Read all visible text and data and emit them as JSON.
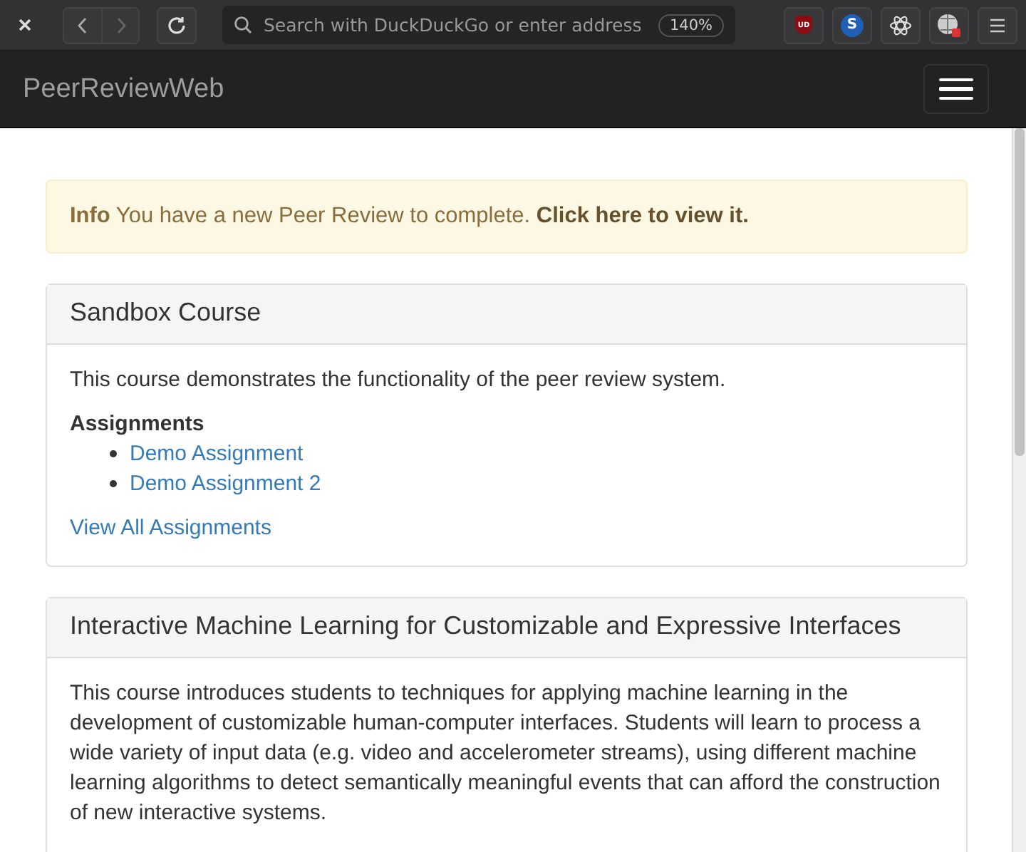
{
  "browser": {
    "search": {
      "placeholder": "Search with DuckDuckGo or enter address"
    },
    "zoom": "140%",
    "extensions": [
      {
        "kind": "shield",
        "label": "UD"
      },
      {
        "kind": "badge",
        "label": "S"
      },
      {
        "kind": "atom"
      },
      {
        "kind": "globe"
      }
    ]
  },
  "navbar": {
    "brand": "PeerReviewWeb"
  },
  "alert": {
    "text": "**Info** You have a new Peer Review to complete.",
    "link": "Click here to view it."
  },
  "courses": [
    {
      "title": "Sandbox Course",
      "description": "This course demonstrates the functionality of the peer review system.",
      "assignments_heading": "Assignments",
      "assignments": [
        "Demo Assignment",
        "Demo Assignment 2"
      ],
      "view_all": "View All Assignments"
    },
    {
      "title": "Interactive Machine Learning for Customizable and Expressive Interfaces",
      "description": "This course introduces students to techniques for applying machine learning in the development of customizable human-computer interfaces. Students will learn to process a wide variety of input data (e.g. video and accelerometer streams), using different machine learning algorithms to detect semantically meaningful events that can afford the construction of new interactive systems."
    }
  ]
}
